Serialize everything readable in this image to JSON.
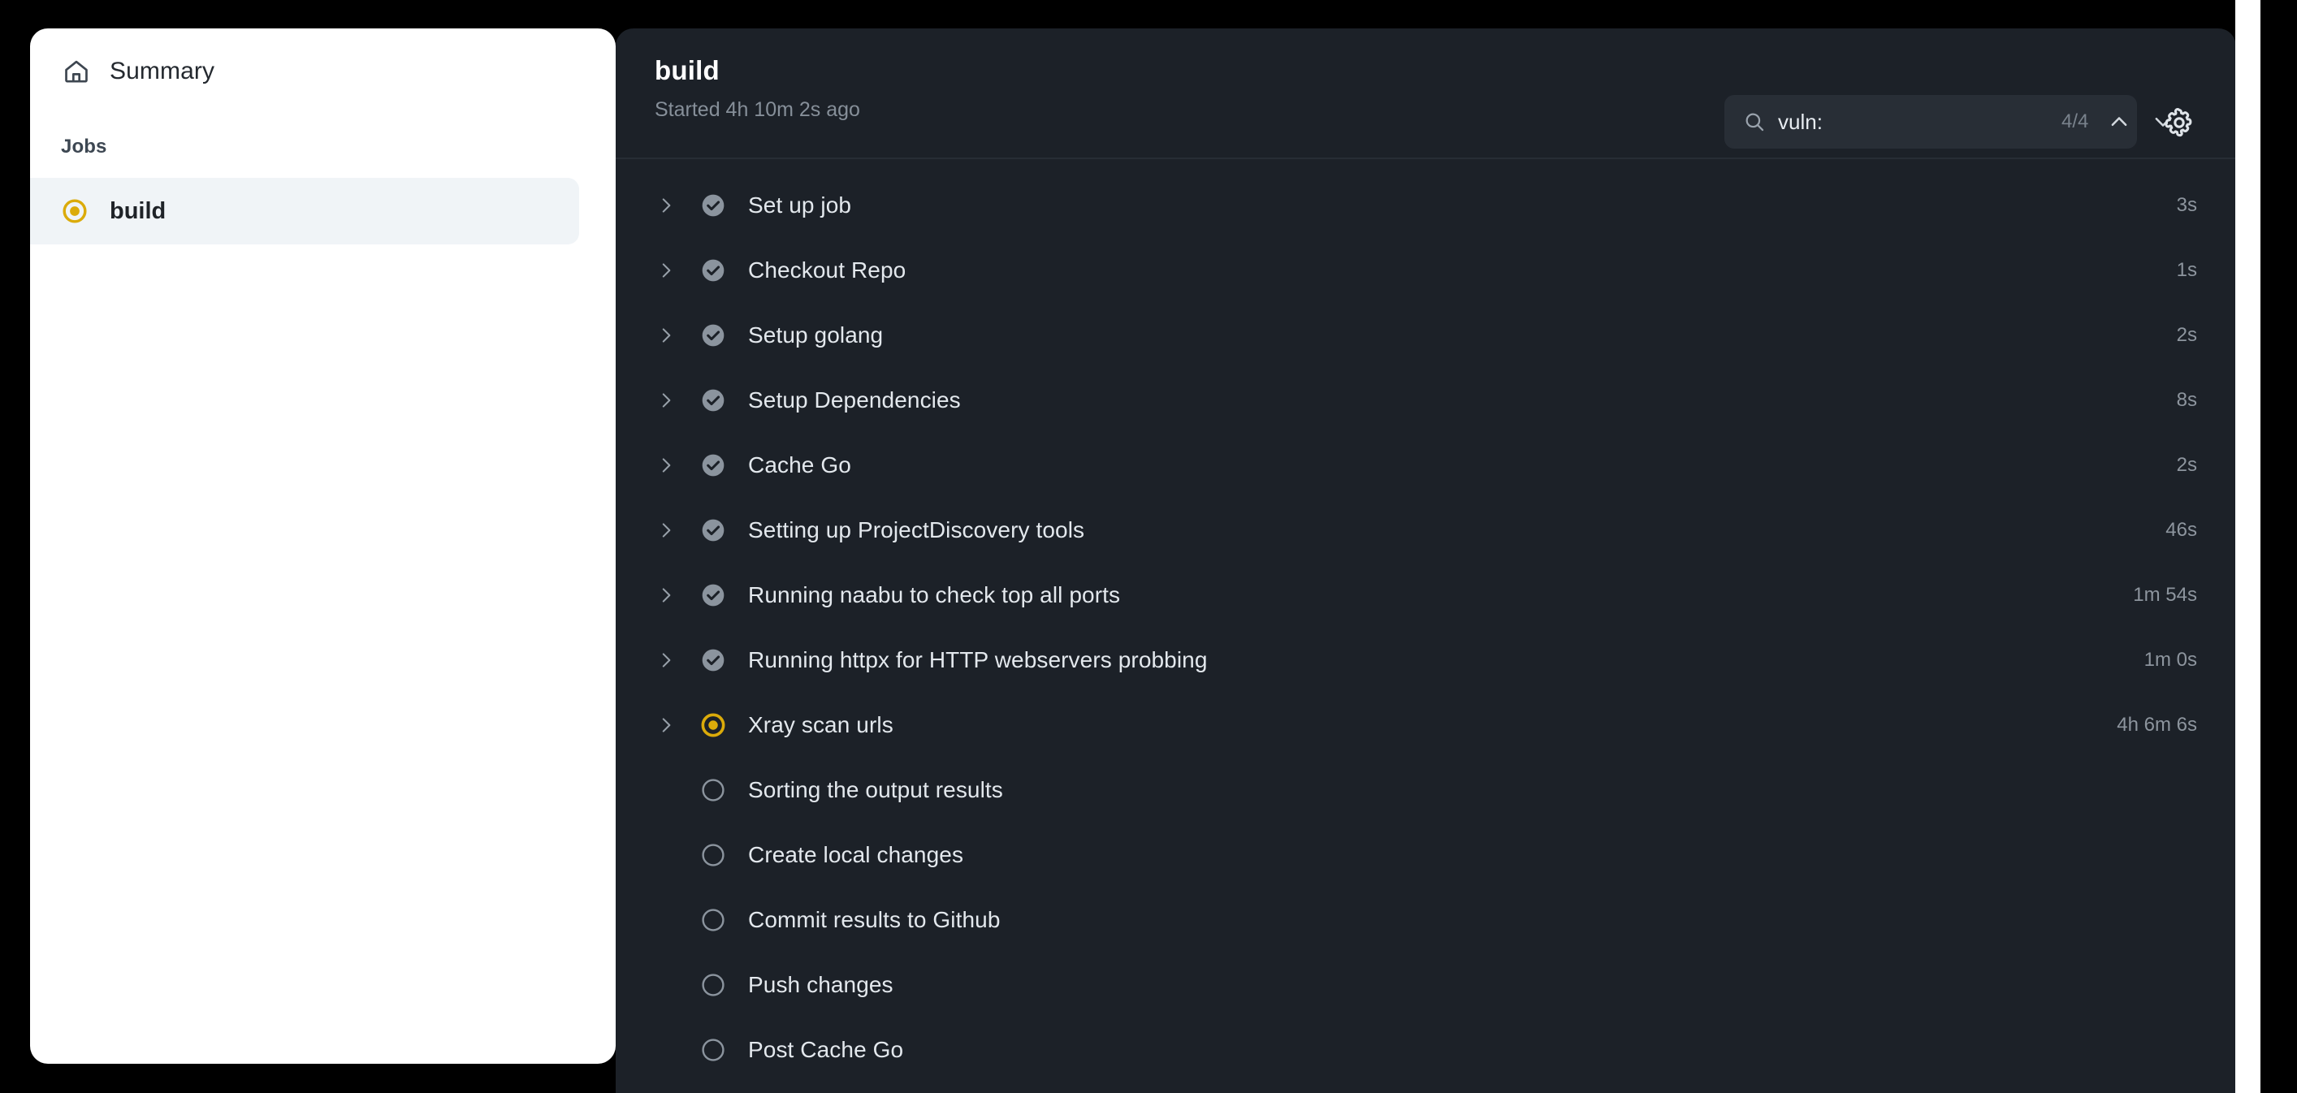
{
  "window": {
    "background_color": "#000000",
    "panel_color": "#1c2128",
    "sidebar_color": "#ffffff",
    "accent_color": "#dbab0a",
    "success_color": "#8b949e"
  },
  "sidebar": {
    "summary": {
      "label": "Summary",
      "icon": "home-icon"
    },
    "jobs_heading": "Jobs",
    "jobs": [
      {
        "label": "build",
        "status": "in-progress",
        "selected": true
      }
    ]
  },
  "header": {
    "title": "build",
    "subtitle": "Started 4h 10m 2s ago",
    "search": {
      "icon": "search-icon",
      "value": "vuln:",
      "placeholder": "Search logs",
      "match_count": "4/4",
      "prev_icon": "chevron-up-icon",
      "next_icon": "chevron-down-icon"
    },
    "settings": {
      "icon": "gear-icon",
      "label": "Settings"
    }
  },
  "steps": [
    {
      "name": "Set up job",
      "status": "success",
      "duration": "3s",
      "expandable": true
    },
    {
      "name": "Checkout Repo",
      "status": "success",
      "duration": "1s",
      "expandable": true
    },
    {
      "name": "Setup golang",
      "status": "success",
      "duration": "2s",
      "expandable": true
    },
    {
      "name": "Setup Dependencies",
      "status": "success",
      "duration": "8s",
      "expandable": true
    },
    {
      "name": "Cache Go",
      "status": "success",
      "duration": "2s",
      "expandable": true
    },
    {
      "name": "Setting up ProjectDiscovery tools",
      "status": "success",
      "duration": "46s",
      "expandable": true
    },
    {
      "name": "Running naabu to check top all ports",
      "status": "success",
      "duration": "1m 54s",
      "expandable": true
    },
    {
      "name": "Running httpx for HTTP webservers probbing",
      "status": "success",
      "duration": "1m 0s",
      "expandable": true
    },
    {
      "name": "Xray scan urls",
      "status": "in-progress",
      "duration": "4h 6m 6s",
      "expandable": true
    },
    {
      "name": "Sorting the output results",
      "status": "pending",
      "duration": "",
      "expandable": false
    },
    {
      "name": "Create local changes",
      "status": "pending",
      "duration": "",
      "expandable": false
    },
    {
      "name": "Commit results to Github",
      "status": "pending",
      "duration": "",
      "expandable": false
    },
    {
      "name": "Push changes",
      "status": "pending",
      "duration": "",
      "expandable": false
    },
    {
      "name": "Post Cache Go",
      "status": "pending",
      "duration": "",
      "expandable": false
    }
  ]
}
